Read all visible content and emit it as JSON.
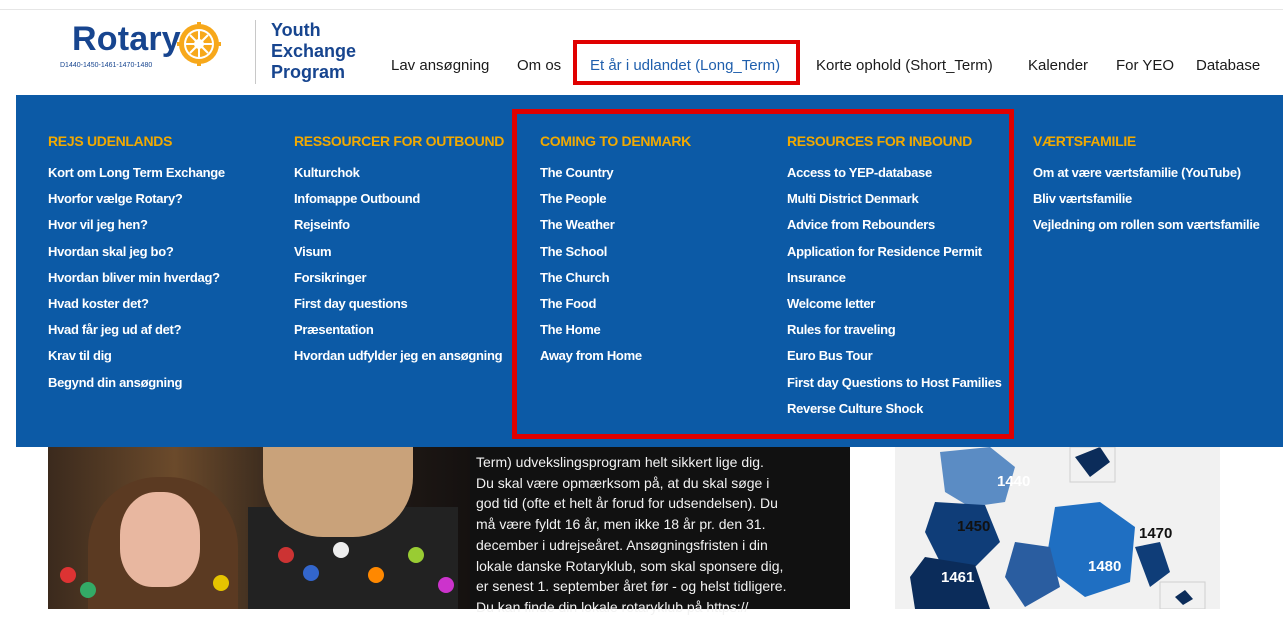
{
  "header": {
    "logo_word": "Rotary",
    "logo_districts": "D1440-1450-1461-1470-1480",
    "program_lines": [
      "Youth",
      "Exchange",
      "Program"
    ]
  },
  "nav": [
    {
      "label": "Lav ansøgning"
    },
    {
      "label": "Om os"
    },
    {
      "label": "Et år i udlandet (Long_Term)",
      "active": true
    },
    {
      "label": "Korte ophold (Short_Term)"
    },
    {
      "label": "Kalender"
    },
    {
      "label": "For YEO"
    },
    {
      "label": "Database"
    }
  ],
  "mega_menu": {
    "columns": [
      {
        "heading": "REJS UDENLANDS",
        "items": [
          "Kort om Long Term Exchange",
          "Hvorfor vælge Rotary?",
          "Hvor vil jeg hen?",
          "Hvordan skal jeg bo?",
          "Hvordan bliver min hverdag?",
          "Hvad koster det?",
          "Hvad får jeg ud af det?",
          "Krav til dig",
          "Begynd din ansøgning"
        ]
      },
      {
        "heading": "RESSOURCER FOR OUTBOUND",
        "items": [
          "Kulturchok",
          "Infomappe Outbound",
          "Rejseinfo",
          "Visum",
          "Forsikringer",
          "First day questions",
          "Præsentation",
          "Hvordan udfylder jeg en ansøgning"
        ]
      },
      {
        "heading": "COMING TO DENMARK",
        "items": [
          "The Country",
          "The People",
          "The Weather",
          "The School",
          "The Church",
          "The Food",
          "The Home",
          "Away from Home"
        ]
      },
      {
        "heading": "RESOURCES FOR INBOUND",
        "items": [
          "Access to YEP-database",
          "Multi District Denmark",
          "Advice from Rebounders",
          "Application for Residence Permit",
          "Insurance",
          "Welcome letter",
          "Rules for traveling",
          "Euro Bus Tour",
          "First day Questions to Host Families",
          "Reverse Culture Shock"
        ]
      },
      {
        "heading": "VÆRTSFAMILIE",
        "items": [
          "Om at være værtsfamilie (YouTube)",
          "Bliv værtsfamilie",
          "Vejledning om rollen som værtsfamilie"
        ]
      }
    ]
  },
  "body_text": {
    "lines": [
      "Term) udvekslingsprogram helt sikkert lige dig.",
      "Du skal være opmærksom på, at du skal søge i",
      "god tid (ofte et helt år forud for udsendelsen). Du",
      "må være fyldt 16 år, men ikke 18 år pr. den 31.",
      "december i udrejseåret. Ansøgningsfristen i din",
      "lokale danske Rotaryklub, som skal sponsere dig,",
      "er senest 1. september året før - og helst tidligere.",
      "Du kan finde din lokale rotaryklub på https://"
    ]
  },
  "district_map": {
    "labels": [
      "1440",
      "1450",
      "1470",
      "1461",
      "1480"
    ]
  },
  "colors": {
    "brand_blue": "#17458f",
    "menu_bg": "#0c5aa6",
    "menu_heading": "#f2a900",
    "highlight_red": "#e00000"
  }
}
